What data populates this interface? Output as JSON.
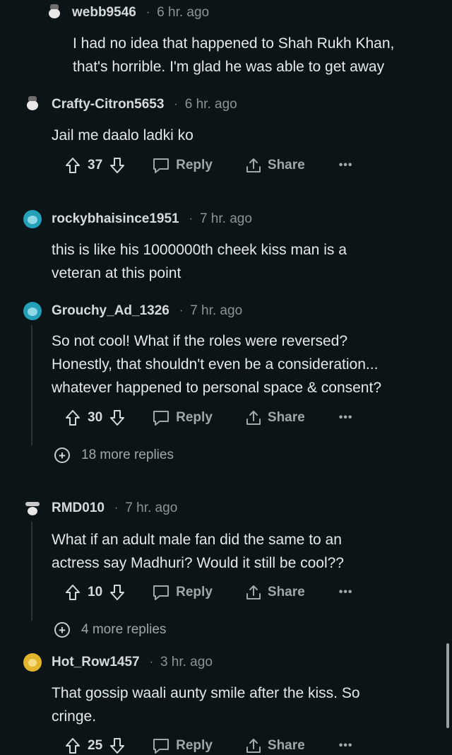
{
  "comments": [
    {
      "username": "webb9546",
      "time": "6 hr. ago",
      "lines": [
        "I had no idea that happened to Shah Rukh Khan,",
        "that's horrible. I'm glad he was able to get away"
      ],
      "avatar": "snoo-white-icon"
    },
    {
      "username": "Crafty-Citron5653",
      "time": "6 hr. ago",
      "lines": [
        "Jail me daalo ladki ko"
      ],
      "votes": "37",
      "avatar": "snoo-white-icon"
    },
    {
      "username": "rockybhaisince1951",
      "time": "7 hr. ago",
      "lines": [
        "this is like his 1000000th cheek kiss man is a",
        "veteran at this point"
      ],
      "avatar": "teal-snoo-icon"
    },
    {
      "username": "Grouchy_Ad_1326",
      "time": "7 hr. ago",
      "lines": [
        "So not cool! What if the roles were reversed?",
        "Honestly, that shouldn't even be a consideration...",
        "whatever happened to personal space & consent?"
      ],
      "votes": "30",
      "more_replies": "18 more replies",
      "avatar": "teal-snoo-icon"
    },
    {
      "username": "RMD010",
      "time": "7 hr. ago",
      "lines": [
        "What if an adult male fan did the same to an",
        "actress say Madhuri? Would it still be cool??"
      ],
      "votes": "10",
      "more_replies": "4 more replies",
      "avatar": "spy-snoo-icon"
    },
    {
      "username": "Hot_Row1457",
      "time": "3 hr. ago",
      "lines": [
        "That gossip waali aunty smile after the kiss. So",
        "cringe."
      ],
      "votes": "25",
      "avatar": "yellow-snoo-icon"
    }
  ],
  "labels": {
    "dot": "·",
    "reply": "Reply",
    "share": "Share",
    "more": "•••",
    "plus": "+"
  },
  "colors": {
    "background": "#0b1416",
    "text": "#d7dadc",
    "muted": "#8b9496",
    "thread_line": "#2a3236"
  }
}
